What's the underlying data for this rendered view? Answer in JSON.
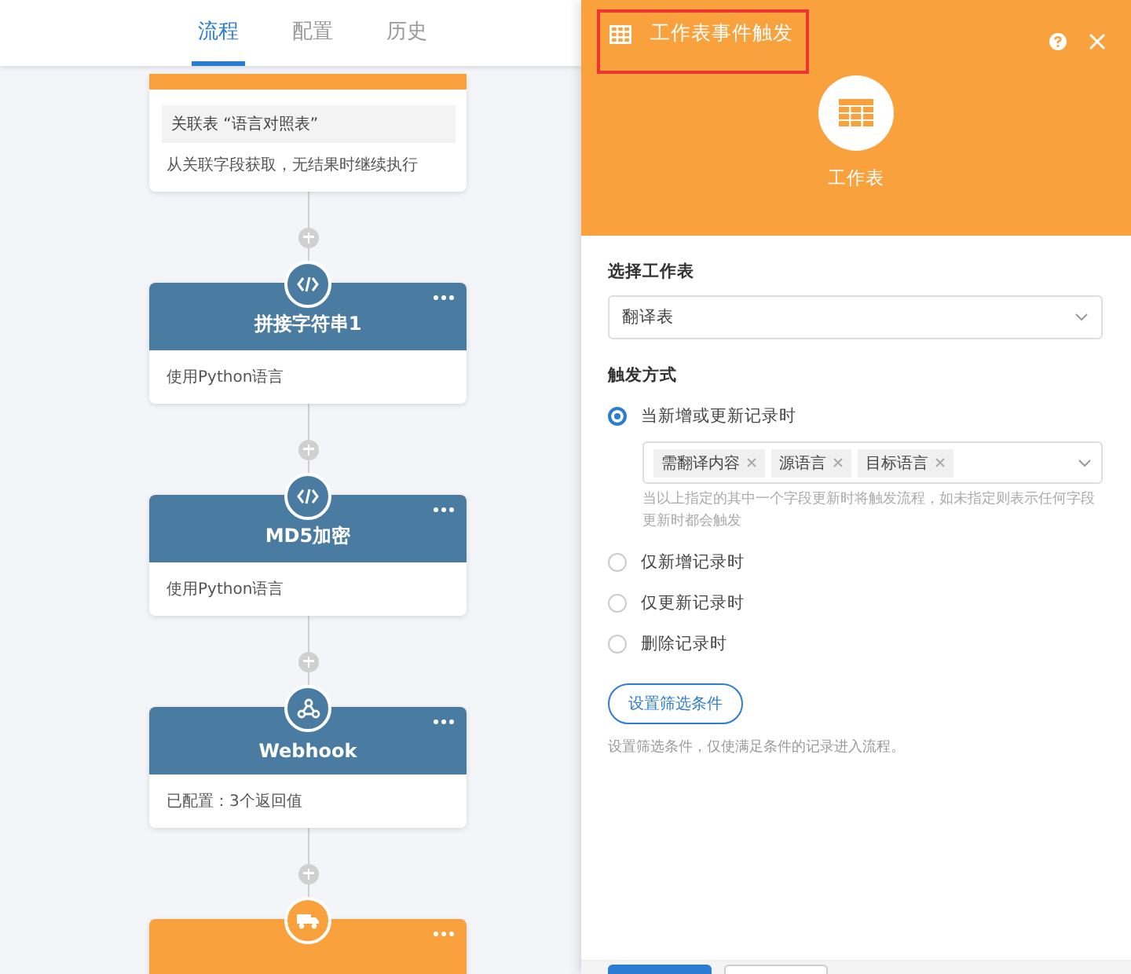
{
  "tabs": [
    {
      "label": "流程",
      "selected": true
    },
    {
      "label": "配置",
      "selected": false
    },
    {
      "label": "历史",
      "selected": false
    }
  ],
  "nodes": [
    {
      "kind": "lookup",
      "highlight": "关联表 “语言对照表”",
      "detail": "从关联字段获取，无结果时继续执行"
    },
    {
      "kind": "code",
      "title": "拼接字符串1",
      "detail": "使用Python语言"
    },
    {
      "kind": "code",
      "title": "MD5加密",
      "detail": "使用Python语言"
    },
    {
      "kind": "webhook",
      "title": "Webhook",
      "detail": "已配置：3个返回值"
    },
    {
      "kind": "action"
    }
  ],
  "panel": {
    "title": "工作表事件触发",
    "title_highlighted": true,
    "icon_label": "工作表",
    "sheet_label": "选择工作表",
    "sheet_value": "翻译表",
    "trigger_label": "触发方式",
    "options": [
      {
        "label": "当新增或更新记录时",
        "selected": true,
        "tags": [
          "需翻译内容",
          "源语言",
          "目标语言"
        ],
        "hint": "当以上指定的其中一个字段更新时将触发流程，如未指定则表示任何字段更新时都会触发"
      },
      {
        "label": "仅新增记录时",
        "selected": false
      },
      {
        "label": "仅更新记录时",
        "selected": false
      },
      {
        "label": "删除记录时",
        "selected": false
      }
    ],
    "filter_button": "设置筛选条件",
    "filter_hint": "设置筛选条件，仅使满足条件的记录进入流程。"
  }
}
